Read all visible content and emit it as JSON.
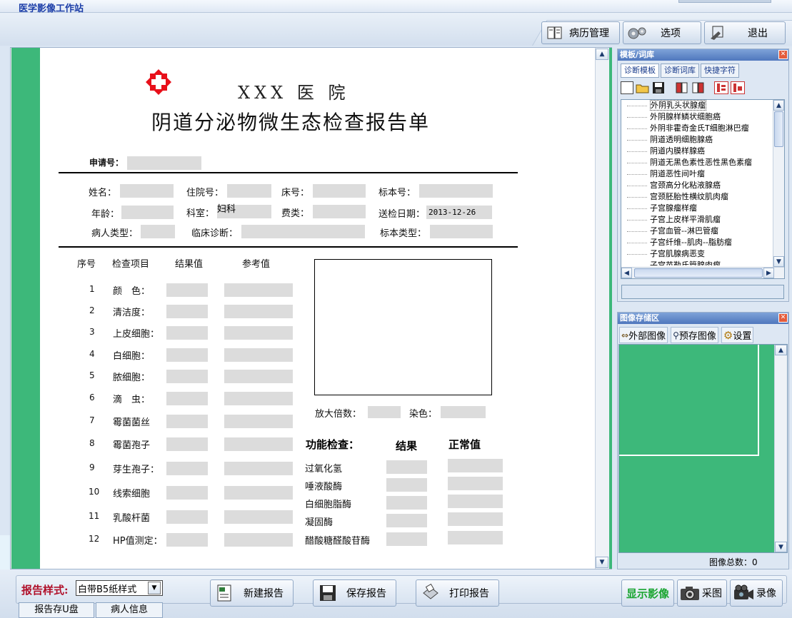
{
  "app_title": "医学影像工作站",
  "toolbar": {
    "case_mgmt": "病历管理",
    "options": "选项",
    "exit": "退出"
  },
  "report": {
    "hospital": "XXX 医 院",
    "title": "阴道分泌物微生态检查报告单",
    "apply_no_label": "申请号：",
    "fields": {
      "name": "姓名：",
      "inpatient_no": "住院号：",
      "bed_no": "床号：",
      "specimen_no": "标本号：",
      "age": "年龄：",
      "department": "科室：",
      "department_value": "妇科",
      "fee_type": "费类：",
      "send_date": "送检日期：",
      "send_date_value": "2013-12-26",
      "patient_type": "病人类型：",
      "clinical_diag": "临床诊断：",
      "specimen_type": "标本类型："
    },
    "table_headers": {
      "no": "序号",
      "item": "检查项目",
      "result": "结果值",
      "reference": "参考值"
    },
    "items": [
      {
        "no": "1",
        "name": "颜　色："
      },
      {
        "no": "2",
        "name": "清洁度："
      },
      {
        "no": "3",
        "name": "上皮细胞："
      },
      {
        "no": "4",
        "name": "白细胞："
      },
      {
        "no": "5",
        "name": "脓细胞："
      },
      {
        "no": "6",
        "name": "滴　虫："
      },
      {
        "no": "7",
        "name": "霉菌菌丝"
      },
      {
        "no": "8",
        "name": "霉菌孢子"
      },
      {
        "no": "9",
        "name": "芽生孢子："
      },
      {
        "no": "10",
        "name": "线索细胞"
      },
      {
        "no": "11",
        "name": "乳酸杆菌"
      },
      {
        "no": "12",
        "name": "HP值测定："
      }
    ],
    "magnification_label": "放大倍数：",
    "stain_label": "染色：",
    "func_headers": {
      "title": "功能检查：",
      "result": "结果",
      "normal": "正常值"
    },
    "func_items": [
      "过氧化氢",
      "唾液酸酶",
      "白细胞脂酶",
      "凝固酶",
      "醋酸糖醛酸苷酶"
    ]
  },
  "template_panel": {
    "title": "模板/词库",
    "tabs": [
      "诊断模板",
      "诊断词库",
      "快捷字符"
    ],
    "items": [
      "外阴乳头状腺瘤",
      "外阴腺样鳞状细胞癌",
      "外阴非霍奇金氏T细胞淋巴瘤",
      "阴道透明细胞腺癌",
      "阴道内膜样腺癌",
      "阴道无黑色素性恶性黑色素瘤",
      "阴道恶性间叶瘤",
      "宫颈高分化粘液腺癌",
      "宫颈胚胎性横纹肌肉瘤",
      "子宫腺瘤样瘤",
      "子宫上皮样平滑肌瘤",
      "子宫血管--淋巴管瘤",
      "子宫纤维--肌肉--脂肪瘤",
      "子宫肌腺病恶变",
      "子宫苗勒氏管腺肉瘤"
    ]
  },
  "image_panel": {
    "title": "图像存储区",
    "external": "外部图像",
    "prestore": "预存图像",
    "settings": "设置",
    "total": "图像总数：0"
  },
  "bottom": {
    "style_label": "报告样式:",
    "style_value": "白带B5纸样式",
    "new_report": "新建报告",
    "save_report": "保存报告",
    "print_report": "打印报告",
    "show_image": "显示影像",
    "capture": "采图",
    "record": "录像",
    "tab_usb": "报告存U盘",
    "tab_patient": "病人信息"
  },
  "colors": {
    "accent_green": "#3db87a",
    "title_blue": "#1c3ea8",
    "cross_red": "#e8101a"
  }
}
